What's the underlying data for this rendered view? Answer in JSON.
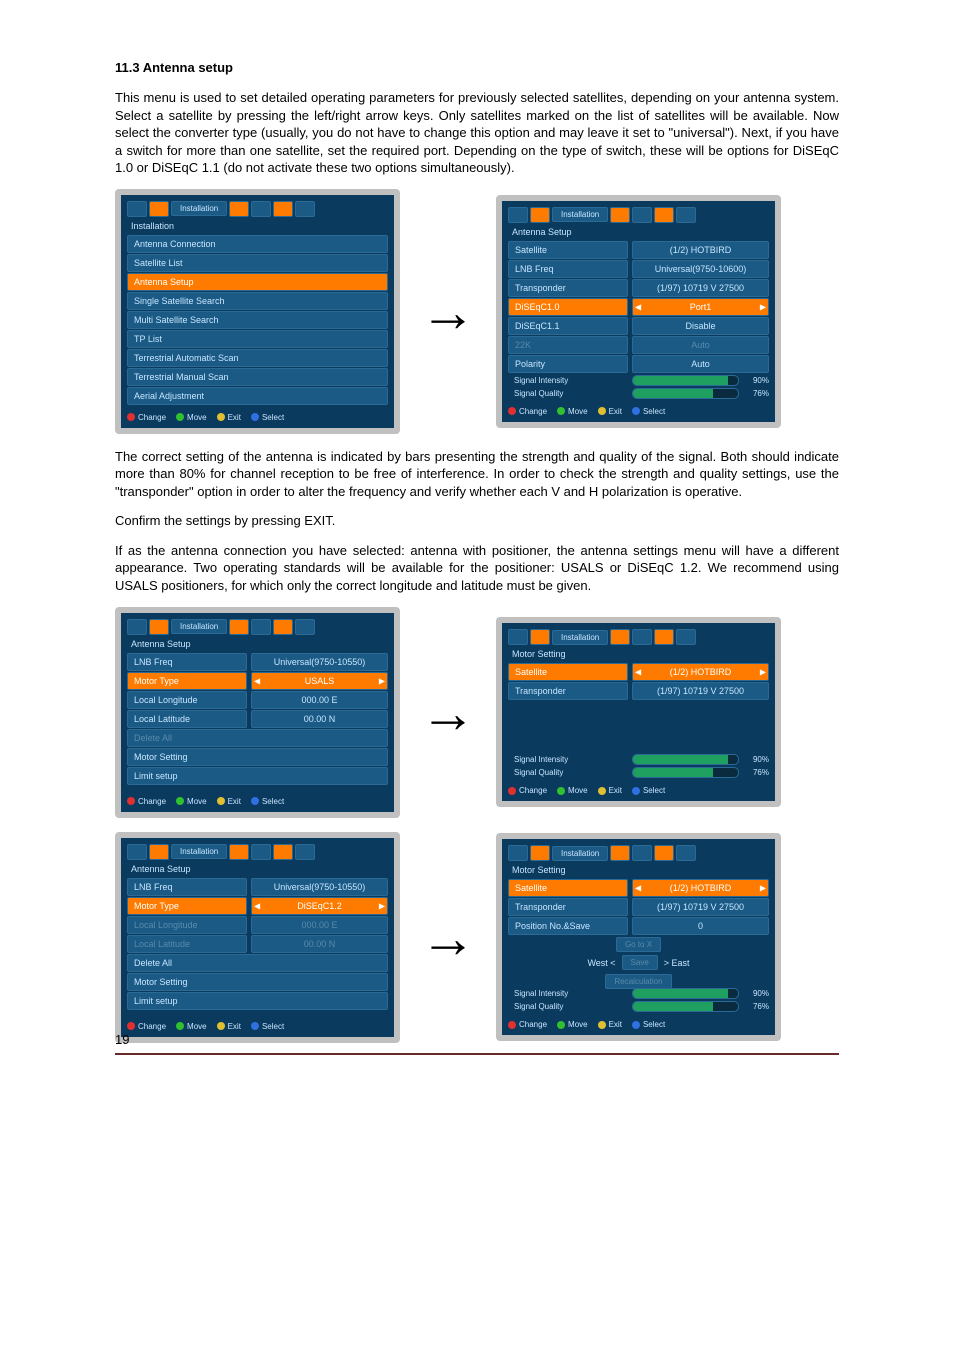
{
  "heading": "11.3 Antenna setup",
  "para1": "This menu is used to set detailed operating parameters for previously selected satellites, depending on your antenna system. Select a satellite by pressing the left/right arrow keys. Only satellites marked on the list of satellites will be available. Now select the converter type (usually, you do not have to change this option and may leave it set to \"universal\"). Next, if you have a switch for more than one satellite, set the required port. Depending on the type of switch, these will be options for DiSEqC 1.0 or DiSEqC 1.1 (do not activate these two options simultaneously).",
  "para2": "The correct setting of the antenna is indicated by bars presenting the strength and quality of the signal. Both should indicate more than 80% for channel reception to be free of interference. In order to check the strength and quality settings, use the \"transponder\" option in order to alter the frequency and verify whether each V and H polarization is operative.",
  "para3": "Confirm the settings by pressing EXIT.",
  "para4": "If as the antenna connection you have selected: antenna with positioner, the antenna settings menu will have a different appearance. Two operating standards will be available for the positioner: USALS or DiSEqC 1.2. We recommend using USALS positioners, for which only the correct longitude and latitude must be given.",
  "page_number": "19",
  "crumb": {
    "installation": "Installation",
    "antenna_setup": "Antenna Setup",
    "motor_setting": "Motor Setting"
  },
  "footer": {
    "change": "Change",
    "move": "Move",
    "exit": "Exit",
    "select": "Select"
  },
  "signal": {
    "intensity_label": "Signal Intensity",
    "quality_label": "Signal Quality",
    "intensity_pct": "90%",
    "quality_pct": "76%"
  },
  "screen1": {
    "title": "Installation",
    "items": [
      "Antenna Connection",
      "Satellite List",
      "Antenna Setup",
      "Single Satellite Search",
      "Multi Satellite Search",
      "TP List",
      "Terrestrial Automatic Scan",
      "Terrestrial Manual Scan",
      "Aerial Adjustment"
    ],
    "selected_index": 2
  },
  "screen2": {
    "title": "Antenna Setup",
    "rows": [
      {
        "k": "Satellite",
        "v": "(1/2) HOTBIRD"
      },
      {
        "k": "LNB Freq",
        "v": "Universal(9750-10600)"
      },
      {
        "k": "Transponder",
        "v": "(1/97) 10719 V 27500"
      },
      {
        "k": "DiSEqC1.0",
        "v": "Port1",
        "sel": true
      },
      {
        "k": "DiSEqC1.1",
        "v": "Disable"
      },
      {
        "k": "22K",
        "v": "Auto",
        "dim": true
      },
      {
        "k": "Polarity",
        "v": "Auto"
      }
    ]
  },
  "screen3": {
    "title": "Antenna Setup",
    "rows": [
      {
        "k": "LNB Freq",
        "v": "Universal(9750-10550)"
      },
      {
        "k": "Motor Type",
        "v": "USALS",
        "sel": true
      },
      {
        "k": "Local Longitude",
        "v": "000.00 E"
      },
      {
        "k": "Local Latitude",
        "v": "00.00 N"
      },
      {
        "k": "Delete All",
        "v": "",
        "dim": true
      },
      {
        "k": "Motor Setting",
        "v": ""
      },
      {
        "k": "Limit setup",
        "v": ""
      }
    ]
  },
  "screen4": {
    "title": "Motor Setting",
    "rows": [
      {
        "k": "Satellite",
        "v": "(1/2) HOTBIRD",
        "sel": true
      },
      {
        "k": "Transponder",
        "v": "(1/97) 10719 V 27500"
      }
    ]
  },
  "screen5": {
    "title": "Antenna Setup",
    "rows": [
      {
        "k": "LNB Freq",
        "v": "Universal(9750-10550)"
      },
      {
        "k": "Motor Type",
        "v": "DiSEqC1.2",
        "sel": true
      },
      {
        "k": "Local Longitude",
        "v": "000.00 E",
        "dim": true
      },
      {
        "k": "Local Latitude",
        "v": "00.00 N",
        "dim": true
      },
      {
        "k": "Delete All",
        "v": ""
      },
      {
        "k": "Motor Setting",
        "v": ""
      },
      {
        "k": "Limit setup",
        "v": ""
      }
    ]
  },
  "screen6": {
    "title": "Motor Setting",
    "rows": [
      {
        "k": "Satellite",
        "v": "(1/2) HOTBIRD",
        "sel": true
      },
      {
        "k": "Transponder",
        "v": "(1/97) 10719 V 27500"
      },
      {
        "k": "Position No.&Save",
        "v": "0"
      }
    ],
    "motor": {
      "goto": "Go to X",
      "west": "West",
      "save": "Save",
      "east": "East",
      "recalc": "Recalculation"
    }
  }
}
